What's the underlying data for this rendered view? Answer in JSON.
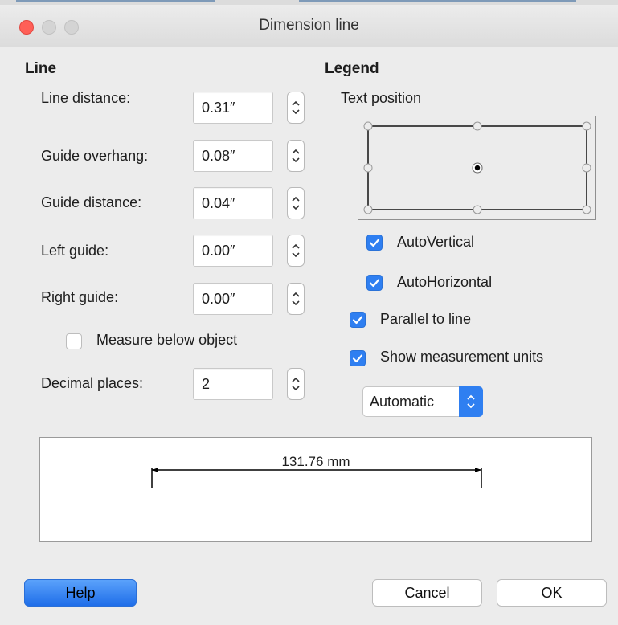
{
  "window": {
    "title": "Dimension line"
  },
  "line_section": {
    "heading": "Line",
    "line_distance": {
      "label": "Line distance:",
      "value": "0.31″"
    },
    "guide_overhang": {
      "label": "Guide overhang:",
      "value": "0.08″"
    },
    "guide_distance": {
      "label": "Guide distance:",
      "value": "0.04″"
    },
    "left_guide": {
      "label": "Left guide:",
      "value": "0.00″"
    },
    "right_guide": {
      "label": "Right guide:",
      "value": "0.00″"
    },
    "measure_below": {
      "label": "Measure below object",
      "checked": false
    },
    "decimal_places": {
      "label": "Decimal places:",
      "value": "2"
    }
  },
  "legend_section": {
    "heading": "Legend",
    "text_position_label": "Text position",
    "selected_position": "center",
    "auto_vertical": {
      "label": "AutoVertical",
      "checked": true
    },
    "auto_horizontal": {
      "label": "AutoHorizontal",
      "checked": true
    },
    "parallel_to_line": {
      "label": "Parallel to line",
      "checked": true
    },
    "show_units": {
      "label": "Show measurement units",
      "checked": true
    },
    "unit_select": {
      "value": "Automatic"
    }
  },
  "preview": {
    "measurement": "131.76 mm"
  },
  "buttons": {
    "help": "Help",
    "cancel": "Cancel",
    "ok": "OK"
  },
  "colors": {
    "accent": "#2f7ff1",
    "close": "#ff5f57"
  }
}
